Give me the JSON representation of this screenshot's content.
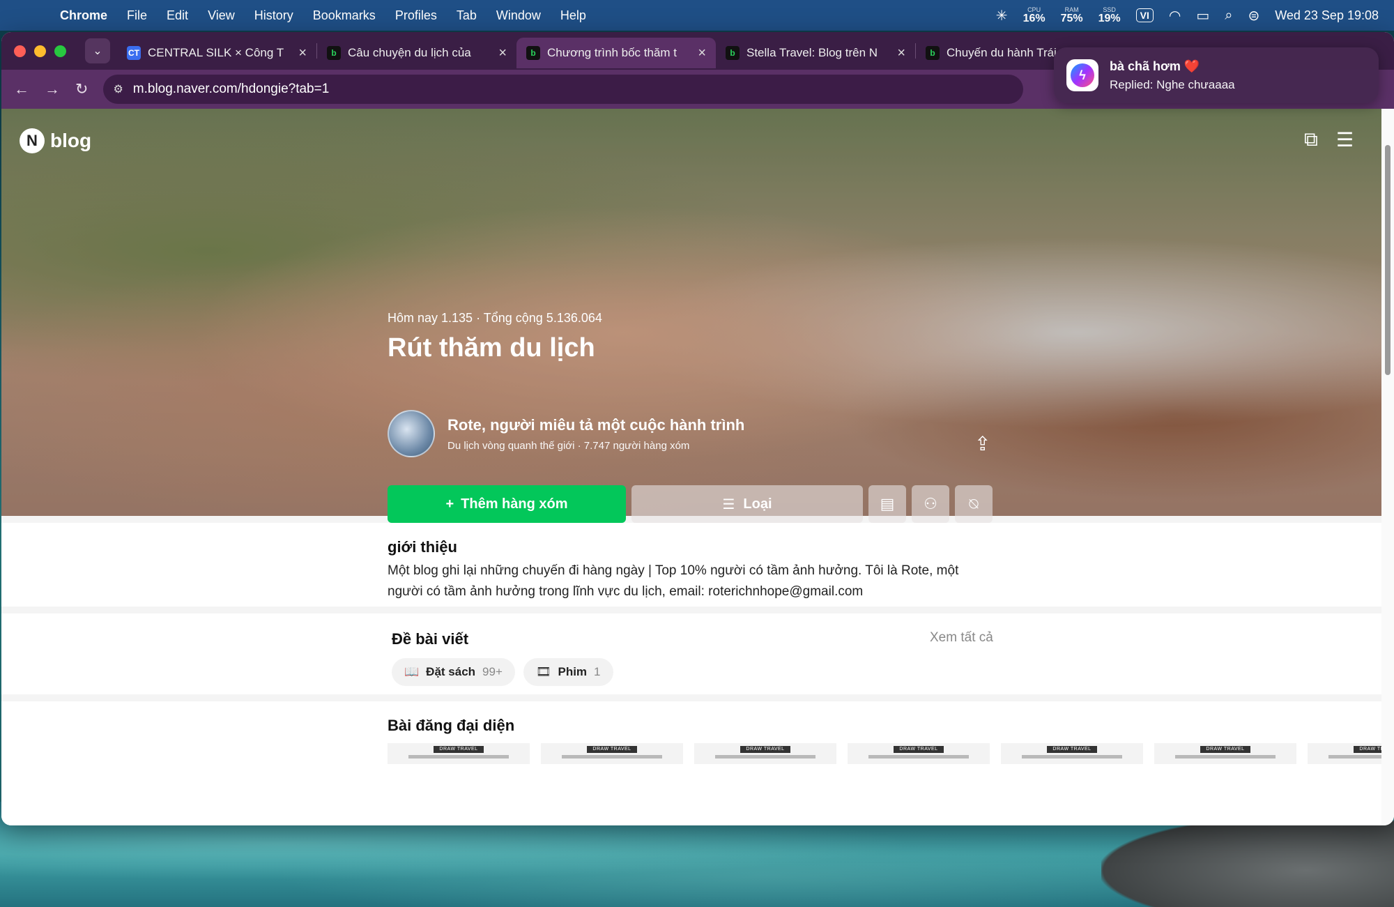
{
  "menubar": {
    "app": "Chrome",
    "items": [
      "File",
      "Edit",
      "View",
      "History",
      "Bookmarks",
      "Profiles",
      "Tab",
      "Window",
      "Help"
    ],
    "cpu_label": "CPU",
    "cpu_value": "16%",
    "ram_label": "RAM",
    "ram_value": "75%",
    "ssd_label": "SSD",
    "ssd_value": "19%",
    "input_method": "VI",
    "datetime": "Wed 23 Sep  19:08"
  },
  "tabs": [
    {
      "favicon": "CT",
      "title": "CENTRAL SILK × Công T"
    },
    {
      "favicon": "b",
      "title": "Câu chuyện du lịch của"
    },
    {
      "favicon": "b",
      "title": "Chương trình bốc thăm t"
    },
    {
      "favicon": "b",
      "title": "Stella Travel: Blog trên N"
    },
    {
      "favicon": "b",
      "title": "Chuyến du hành Trái"
    }
  ],
  "address": "m.blog.naver.com/hdongie?tab=1",
  "notification": {
    "title": "bà chã hơm",
    "heart": "❤️",
    "body": "Replied: Nghe chưaaaa"
  },
  "blog": {
    "logo_letter": "N",
    "logo_text": "blog",
    "stats": "Hôm nay 1.135 · Tổng cộng 5.136.064",
    "title": "Rút thăm du lịch",
    "author_name": "Rote, người miêu tả một cuộc hành trình",
    "author_sub": "Du lịch vòng quanh thế giới · 7.747 người hàng xóm",
    "add_neighbor": "Thêm hàng xóm",
    "category": "Loại"
  },
  "intro": {
    "heading": "giới thiệu",
    "text": "Một blog ghi lại những chuyến đi hàng ngày | Top 10% người có tầm ảnh hưởng. Tôi là Rote, một người có tầm ảnh hưởng trong lĩnh vực du lịch, email: roterichnhope@gmail.com"
  },
  "topics": {
    "heading": "Đề bài viết",
    "see_all": "Xem tất cả",
    "chips": [
      {
        "label": "Đặt sách",
        "count": "99+"
      },
      {
        "label": "Phim",
        "count": "1"
      }
    ]
  },
  "featured": {
    "heading": "Bài đăng đại diện",
    "thumb_tag": "DRAW TRAVEL",
    "thumb_count": 7
  },
  "colors": {
    "accent_green": "#03c75a",
    "menubar": "#1f4f86",
    "tabbar": "#3a1e45"
  }
}
